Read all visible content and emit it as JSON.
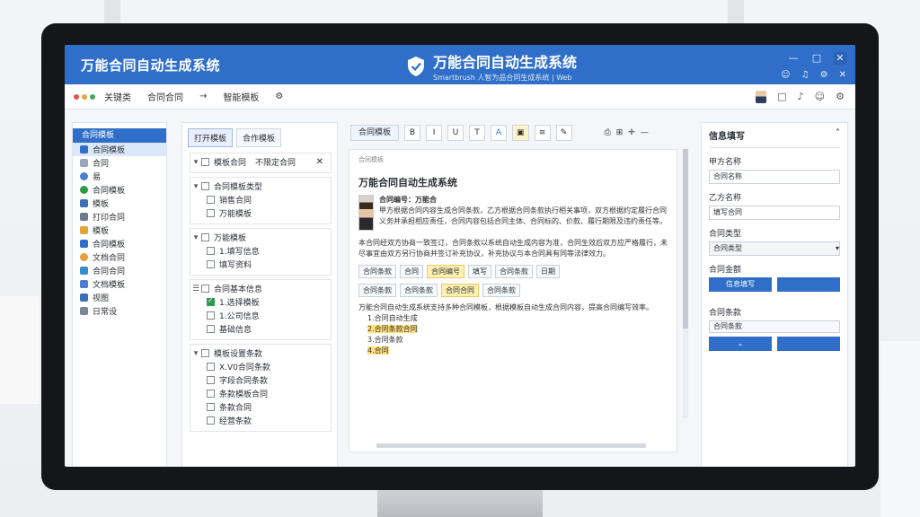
{
  "window": {
    "title_left": "万能合同自动生成系统",
    "title_center": "万能合同自动生成系统",
    "subtitle_center": "Smartbrush 人智为品合同生成系统 | Web",
    "controls": {
      "minimize": "—",
      "maximize": "□",
      "close": "✕"
    }
  },
  "toolbar": {
    "items": [
      "关键类",
      "合同合同",
      "→",
      "智能模板"
    ],
    "right_icons": [
      "avatar",
      "square-icon",
      "bell-icon",
      "user-icon",
      "settings-icon"
    ]
  },
  "sidebar": {
    "header": "合同模板",
    "items": [
      "合同模板",
      "合同",
      "易",
      "合同模板",
      "模板",
      "打印合同",
      "模板",
      "合同模板",
      "文档合同",
      "合同合同",
      "文档模板",
      "视图",
      "日常设"
    ]
  },
  "tree": {
    "tabs": [
      "打开模板",
      "合作模板"
    ],
    "sections": [
      {
        "title": "模板合同",
        "extra": "不限定合同",
        "items": []
      },
      {
        "title": "合同模板类型",
        "items": [
          "销售合同",
          "万能模板"
        ]
      },
      {
        "title": "万能模板",
        "items": [
          "1.填写信息",
          "填写资料"
        ]
      },
      {
        "title": "合同基本信息",
        "items": [
          "1.选择模板",
          "1.公司信息",
          "基础信息"
        ],
        "checked_index": 0
      },
      {
        "title": "模板设置条款",
        "items": [
          "X.V0合同条款",
          "字段合同条款",
          "条款模板合同",
          "条款合同",
          "经营条款"
        ]
      }
    ]
  },
  "editor": {
    "toolbar_left": "合同模板",
    "toolbar_buttons": [
      "B",
      "I",
      "U",
      "T",
      "A",
      "▣",
      "≡",
      "✎"
    ],
    "toolbar_right": [
      "⎙",
      "⊞",
      "✛",
      "—"
    ],
    "doc_tag": "合同模板",
    "doc_title": "万能合同自动生成系统",
    "header_line": "合同编号：万能合",
    "para1": "甲方根据合同内容生成合同条款，乙方根据合同条款执行相关事项，双方根据约定履行合同义务并承担相应责任，合同内容包括合同主体、合同标的、价款、履行期限及违约责任等。",
    "para2": "本合同经双方协商一致签订，合同条款以系统自动生成内容为准，合同生效后双方应严格履行，未尽事宜由双方另行协商并签订补充协议，补充协议与本合同具有同等法律效力。",
    "field_chips": [
      "合同条款",
      "合同",
      "合同编号",
      "填写",
      "合同条款",
      "日期"
    ],
    "field_chips_row2": [
      "合同条款",
      "合同条款",
      "合同合同",
      "合同条款"
    ],
    "para3": "万能合同自动生成系统支持多种合同模板，根据模板自动生成合同内容，提高合同编写效率。",
    "list": [
      "1.合同自动生成",
      "2.合同条款合同",
      "3.合同条款",
      "4.合同"
    ]
  },
  "right_panel": {
    "title": "信息填写",
    "fields": [
      {
        "label": "甲方名称",
        "value": "合同名称"
      },
      {
        "label": "乙方名称",
        "value": "填写合同"
      },
      {
        "label": "合同类型",
        "value": "合同类型",
        "type": "select"
      },
      {
        "label": "合同金额",
        "buttons": [
          "信息填写",
          ""
        ]
      },
      {
        "label": "合同条款",
        "value": "合同条款",
        "buttons2": [
          "",
          ""
        ]
      }
    ]
  },
  "colors": {
    "brand": "#2f6fc9",
    "highlight": "#ffe07a",
    "success": "#2f9b4a"
  }
}
